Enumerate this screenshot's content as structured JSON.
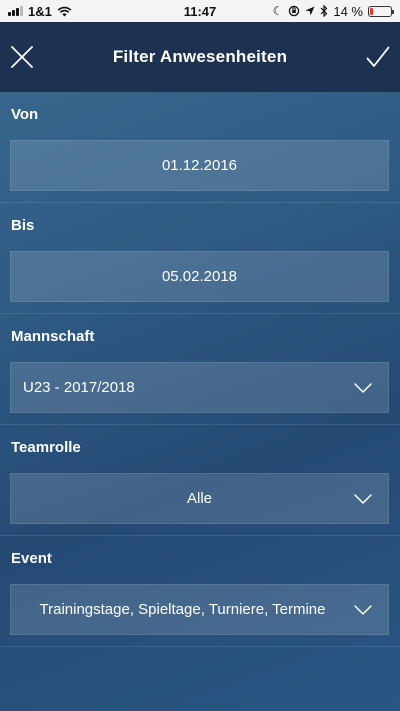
{
  "status_bar": {
    "carrier": "1&1",
    "time": "11:47",
    "battery_percent": "14 %",
    "battery_level": 0.14,
    "icons": [
      "signal-icon",
      "wifi-icon",
      "moon-icon",
      "orientation-lock-icon",
      "location-icon",
      "bluetooth-icon",
      "battery-icon"
    ]
  },
  "navbar": {
    "title": "Filter Anwesenheiten",
    "close_icon": "close-icon",
    "confirm_icon": "checkmark-icon"
  },
  "form": {
    "von": {
      "label": "Von",
      "value": "01.12.2016"
    },
    "bis": {
      "label": "Bis",
      "value": "05.02.2018"
    },
    "mannschaft": {
      "label": "Mannschaft",
      "value": "U23 - 2017/2018"
    },
    "teamrolle": {
      "label": "Teamrolle",
      "value": "Alle"
    },
    "event": {
      "label": "Event",
      "value": "Trainingstage, Spieltage, Turniere, Termine"
    }
  },
  "colors": {
    "status_bar_bg": "#f4f4f6",
    "navbar_bg": "#1c3250",
    "background": "#2f5b84",
    "battery_low": "#e53935",
    "text": "#ffffff"
  }
}
